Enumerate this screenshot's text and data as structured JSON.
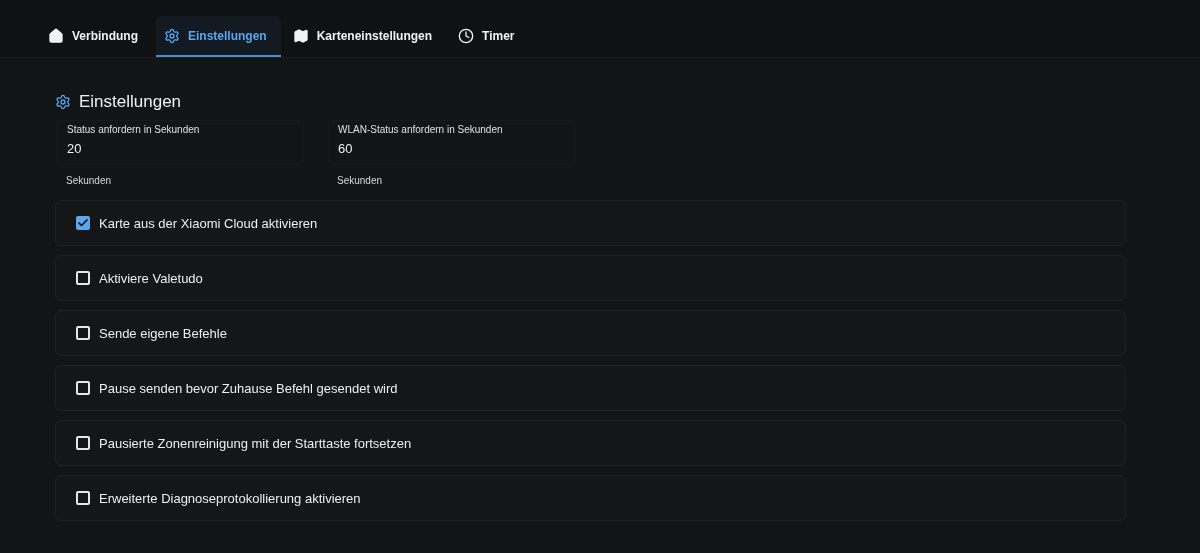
{
  "tabs": [
    {
      "label": "Verbindung",
      "kind": "home",
      "selected": false
    },
    {
      "label": "Einstellungen",
      "kind": "gear",
      "selected": true
    },
    {
      "label": "Karteneinstellungen",
      "kind": "map",
      "selected": false
    },
    {
      "label": "Timer",
      "kind": "clock",
      "selected": false
    }
  ],
  "section": {
    "title": "Einstellungen"
  },
  "fields": [
    {
      "label": "Status anfordern in Sekunden",
      "value": "20",
      "helper": "Sekunden"
    },
    {
      "label": "WLAN-Status anfordern in Sekunden",
      "value": "60",
      "helper": "Sekunden"
    }
  ],
  "options": [
    {
      "label": "Karte aus der Xiaomi Cloud aktivieren",
      "checked": true
    },
    {
      "label": "Aktiviere Valetudo",
      "checked": false
    },
    {
      "label": "Sende eigene Befehle",
      "checked": false
    },
    {
      "label": "Pause senden bevor Zuhause Befehl gesendet wird",
      "checked": false
    },
    {
      "label": "Pausierte Zonenreinigung mit der Starttaste fortsetzen",
      "checked": false
    },
    {
      "label": "Erweiterte Diagnoseprotokollierung aktivieren",
      "checked": false
    }
  ]
}
